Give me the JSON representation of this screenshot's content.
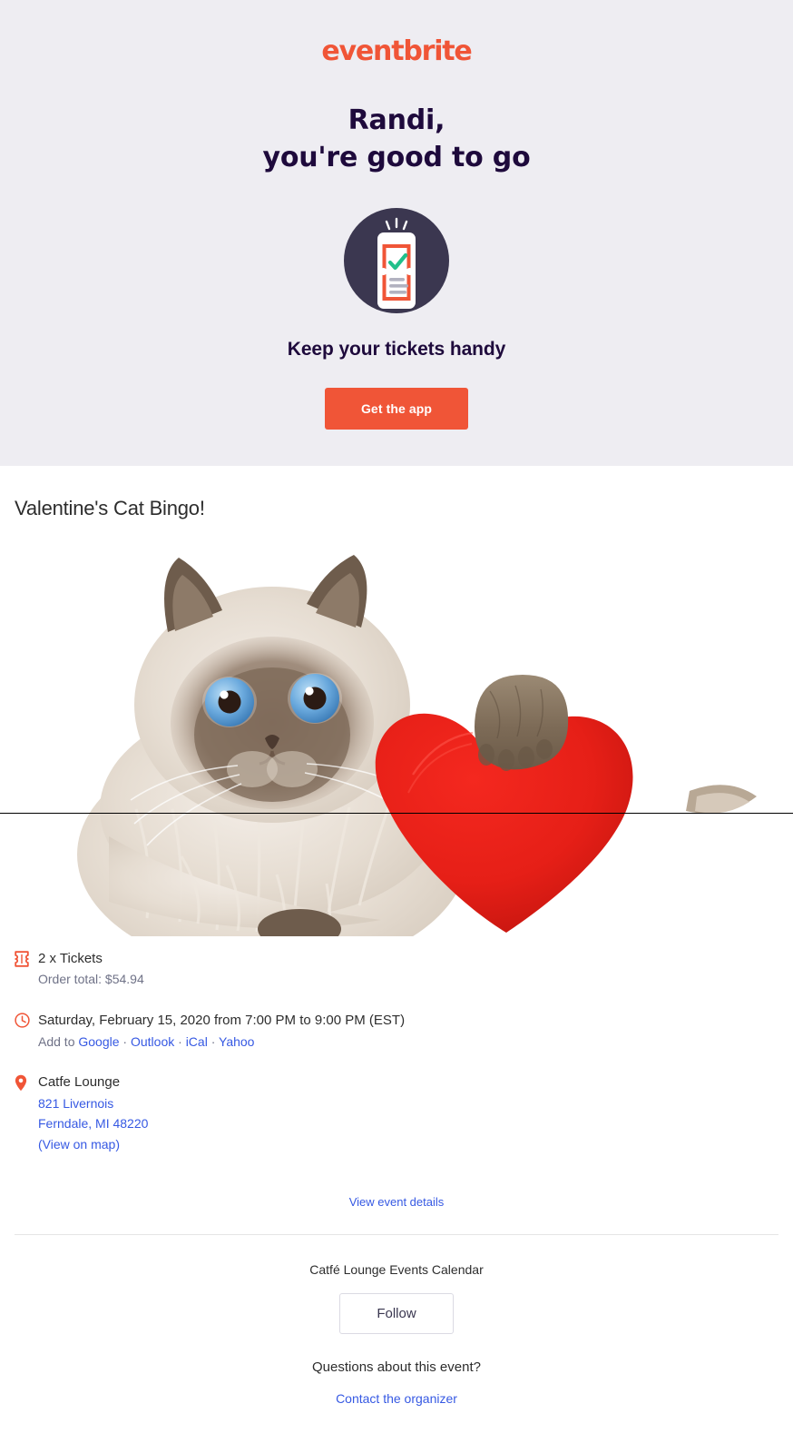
{
  "hero": {
    "brand": "eventbrite",
    "greeting_line1": "Randi,",
    "greeting_line2": "you're good to go",
    "illustration_icon": "phone-ticket-check-icon",
    "subheading": "Keep your tickets handy",
    "cta_label": "Get the app",
    "background_color": "#eeedf2",
    "accent_color": "#f05537",
    "heading_color": "#1e0a3c"
  },
  "event": {
    "title": "Valentine's Cat Bingo!",
    "image_alt": "Himalayan cat with red plush heart"
  },
  "tickets": {
    "icon": "ticket-icon",
    "quantity_label": "2 x Tickets",
    "order_total_label": "Order total: $54.94"
  },
  "datetime": {
    "icon": "clock-icon",
    "when": "Saturday, February 15, 2020 from 7:00 PM to 9:00 PM (EST)",
    "add_to_prefix": "Add to ",
    "calendar_links": [
      "Google",
      "Outlook",
      "iCal",
      "Yahoo"
    ],
    "separator": " · "
  },
  "venue": {
    "icon": "map-pin-icon",
    "name": "Catfe Lounge",
    "street": "821 Livernois",
    "city_state_zip": "Ferndale, MI 48220",
    "map_link": "(View on map)"
  },
  "links": {
    "view_event_details": "View event details"
  },
  "organizer": {
    "name": "Catfé Lounge Events Calendar",
    "follow_label": "Follow",
    "questions_label": "Questions about this event?",
    "contact_label": "Contact the organizer"
  },
  "colors": {
    "link_blue": "#3659e3",
    "muted_gray": "#6f7287",
    "text_dark": "#2d2d2d"
  }
}
